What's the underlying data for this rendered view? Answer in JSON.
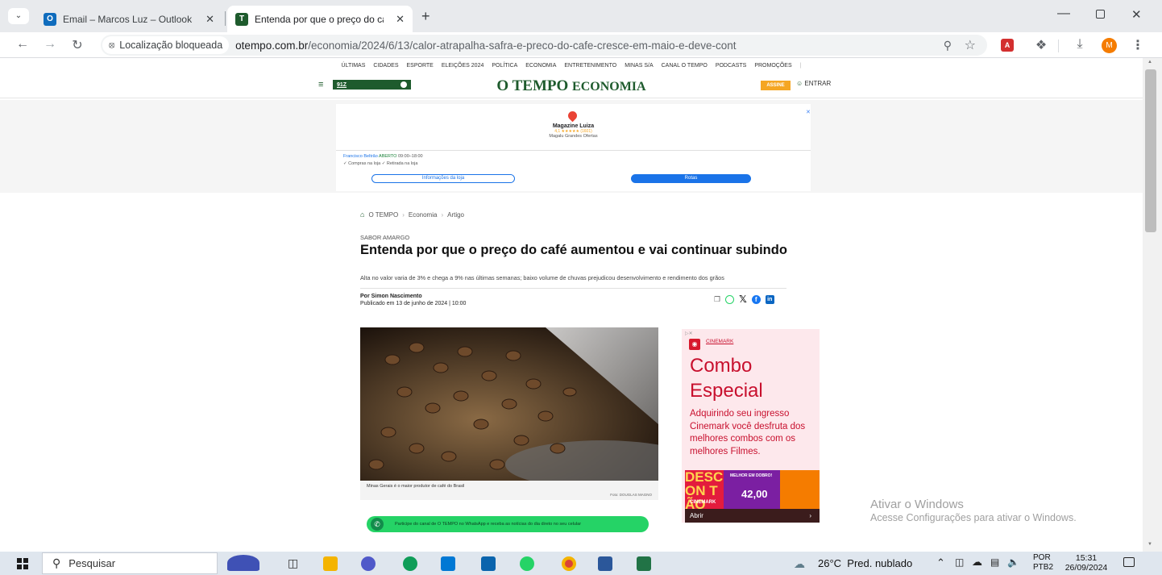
{
  "browser": {
    "tabs": [
      {
        "label": "Email – Marcos Luz – Outlook",
        "favicon_letter": "O",
        "favicon_color": "#0f6cbd"
      },
      {
        "label": "Entenda por que o preço do ca",
        "favicon_letter": "T",
        "favicon_color": "#1e5b2d"
      }
    ],
    "new_tab": "+",
    "location_blocked": "Localização bloqueada",
    "url_domain": "otempo.com.br",
    "url_path": "/economia/2024/6/13/calor-atrapalha-safra-e-preco-do-cafe-cresce-em-maio-e-deve-cont",
    "profile_initial": "M"
  },
  "site": {
    "nav": [
      "ÚLTIMAS",
      "CIDADES",
      "ESPORTE",
      "ELEIÇÕES 2024",
      "POLÍTICA",
      "ECONOMIA",
      "ENTRETENIMENTO",
      "MINAS S/A",
      "CANAL O TEMPO",
      "PODCASTS",
      "PROMOÇÕES"
    ],
    "radio_label": "91Z",
    "logo": "O TEMPO",
    "section": "ECONOMIA",
    "subscribe": "ASSINE",
    "login": "ENTRAR"
  },
  "ad_top": {
    "store_name": "Magazine Luiza",
    "rating": "4,1 ★★★★★ (1601)",
    "store_sub": "Magalu Grandes Ofertas",
    "location": "Francisco Beltrão",
    "status": "ABERTO",
    "hours": "09:00–18:00",
    "features": "✓ Compras na loja  ✓ Retirada na loja",
    "info_button": "Informações da loja",
    "routes_button": "Rotas"
  },
  "article": {
    "breadcrumb": [
      "O TEMPO",
      "Economia",
      "Artigo"
    ],
    "kicker": "SABOR AMARGO",
    "title": "Entenda por que o preço do café aumentou e vai continuar subindo",
    "subtitle": "Alta no valor varia de 3% e chega a 9% nas últimas semanas; baixo volume de chuvas prejudicou desenvolvimento e rendimento dos grãos",
    "author": "Por Simon Nascimento",
    "published": "Publicado em 13 de junho de 2024 | 10:00",
    "photo_caption": "Minas Gerais é o maior produtor de café do Brasil",
    "photo_credit": "Foto: DOUGLAS MAGNO",
    "whatsapp_banner": "Participe do canal de O TEMPO no WhatsApp e receba as notícias do dia direto no seu celular"
  },
  "ad_side": {
    "brand": "CINEMARK",
    "headline_1": "Combo",
    "headline_2": "Especial",
    "body": "Adquirindo seu ingresso Cinemark você desfruta dos melhores combos com os melhores Filmes.",
    "promo_left": "DESCON TÃO",
    "promo_badge": "MELHOR EM DOBRO!",
    "promo_price": "42,00",
    "promo_brand": "CINEMARK",
    "cta": "Abrir"
  },
  "watermark": {
    "line1": "Ativar o Windows",
    "line2": "Acesse Configurações para ativar o Windows."
  },
  "taskbar": {
    "search_placeholder": "Pesquisar",
    "weather": "26°C  Pred. nublado",
    "lang_1": "POR",
    "lang_2": "PTB2",
    "time": "15:31",
    "date": "26/09/2024"
  }
}
